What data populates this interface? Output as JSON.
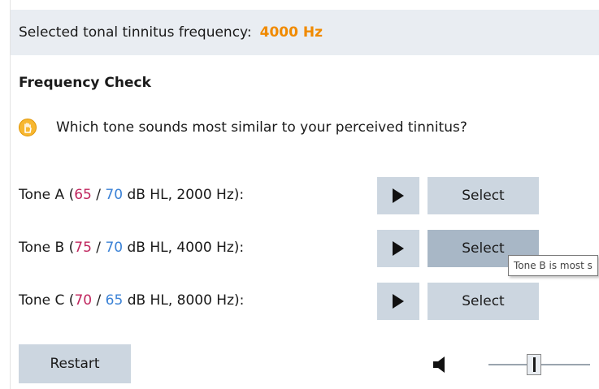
{
  "header": {
    "label": "Selected tonal tinnitus frequency:",
    "value": "4000 Hz"
  },
  "section": {
    "title": "Frequency Check"
  },
  "question": {
    "icon": "hand-stop-icon",
    "text": "Which tone sounds most similar to your perceived tinnitus?"
  },
  "tones": [
    {
      "name": "Tone A",
      "left_db": "65",
      "right_db": "70",
      "unit": "dB HL",
      "freq": "2000 Hz",
      "select_label": "Select"
    },
    {
      "name": "Tone B",
      "left_db": "75",
      "right_db": "70",
      "unit": "dB HL",
      "freq": "4000 Hz",
      "select_label": "Select"
    },
    {
      "name": "Tone C",
      "left_db": "70",
      "right_db": "65",
      "unit": "dB HL",
      "freq": "8000 Hz",
      "select_label": "Select"
    }
  ],
  "tooltip": {
    "text": "Tone B is most s"
  },
  "footer": {
    "restart_label": "Restart",
    "volume_level": 0.45
  },
  "colors": {
    "accent": "#f08a00",
    "left_ear": "#c0265e",
    "right_ear": "#3b82d6",
    "button_bg": "#ccd6e0",
    "button_hover": "#a8b7c6",
    "header_bg": "#e9edf2"
  }
}
